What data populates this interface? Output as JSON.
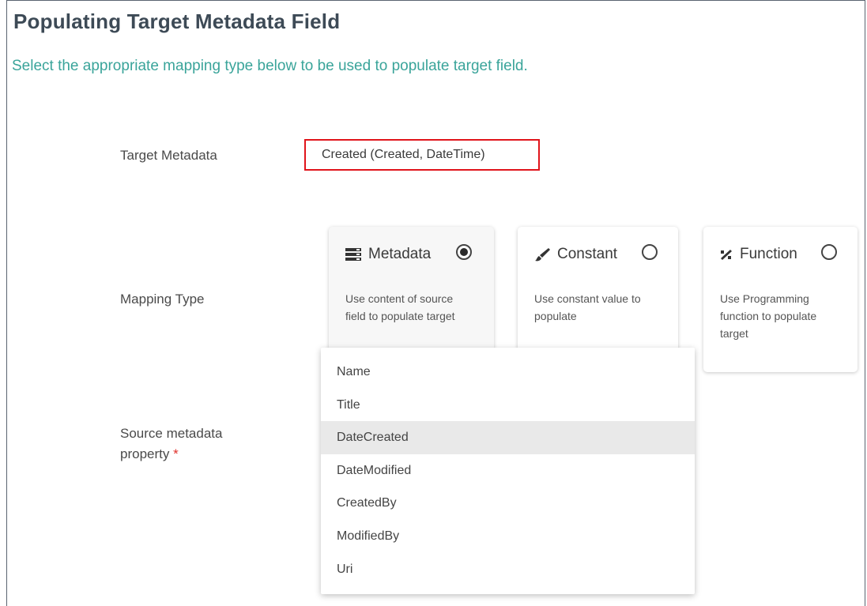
{
  "page": {
    "title": "Populating Target Metadata Field",
    "subtitle": "Select the appropriate mapping type below to be used to populate target field."
  },
  "target_metadata": {
    "label": "Target Metadata",
    "value": "Created (Created, DateTime)"
  },
  "mapping_type": {
    "label": "Mapping Type",
    "selected": "Metadata",
    "options": [
      {
        "icon": "database-icon",
        "title": "Metadata",
        "description": "Use content of source field to populate target",
        "checked": true
      },
      {
        "icon": "brush-icon",
        "title": "Constant",
        "description": "Use constant value to populate",
        "checked": false
      },
      {
        "icon": "percent-icon",
        "title": "Function",
        "description": "Use Programming function to populate target",
        "checked": false
      }
    ]
  },
  "source_metadata": {
    "label_line1": "Source metadata",
    "label_line2": "property",
    "required_mark": "*",
    "options": [
      "Name",
      "Title",
      "DateCreated",
      "DateModified",
      "CreatedBy",
      "ModifiedBy",
      "Uri"
    ],
    "highlighted": "DateCreated"
  },
  "colors": {
    "title": "#3d4a56",
    "subtitle": "#3aa49a",
    "highlight_border": "#e0141b",
    "required": "#e0312b",
    "hover_row": "#e9e9e9"
  }
}
